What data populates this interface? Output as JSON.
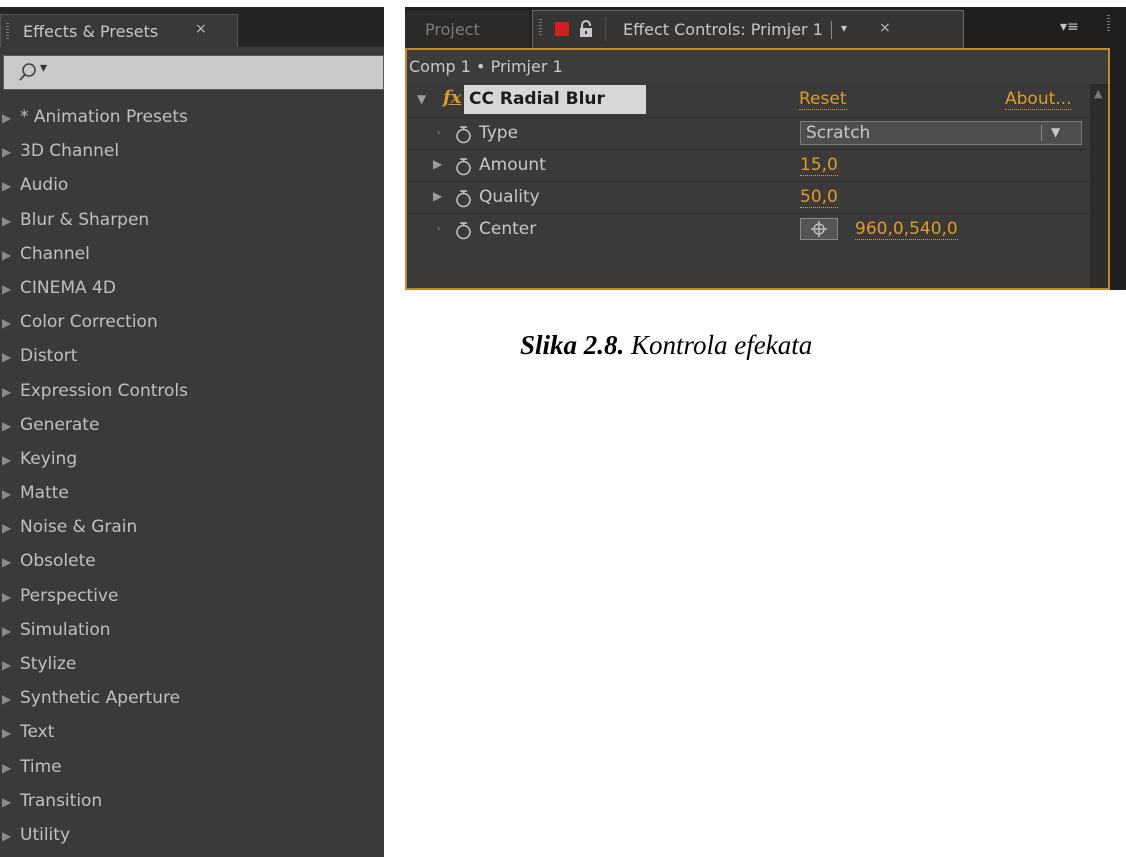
{
  "effects_panel": {
    "tab_label": "Effects & Presets",
    "close_glyph": "×",
    "search_icon": "search-icon",
    "search_dropdown_glyph": "▾",
    "items": [
      "* Animation Presets",
      "3D Channel",
      "Audio",
      "Blur & Sharpen",
      "Channel",
      "CINEMA 4D",
      "Color Correction",
      "Distort",
      "Expression Controls",
      "Generate",
      "Keying",
      "Matte",
      "Noise & Grain",
      "Obsolete",
      "Perspective",
      "Simulation",
      "Stylize",
      "Synthetic Aperture",
      "Text",
      "Time",
      "Transition",
      "Utility"
    ]
  },
  "effect_controls": {
    "tab_project": "Project",
    "tab_label": "Effect Controls: Primjer 1",
    "tab_menu_glyph": "▾",
    "close_glyph": "×",
    "panel_menu_glyph": "▾≡",
    "subheader": "Comp 1 • Primjer 1",
    "effect": {
      "fx_glyph": "fx",
      "name": "CC Radial Blur",
      "reset_label": "Reset",
      "about_label": "About..."
    },
    "properties": {
      "type": {
        "label": "Type",
        "value": "Scratch"
      },
      "amount": {
        "label": "Amount",
        "value": "15,0"
      },
      "quality": {
        "label": "Quality",
        "value": "50,0"
      },
      "center": {
        "label": "Center",
        "value": "960,0,540,0"
      }
    },
    "accent_color": "#e39a27",
    "highlight_border": "#c5872a"
  },
  "caption": {
    "bold_part": "Slika 2.8.",
    "rest": " Kontrola efekata"
  }
}
